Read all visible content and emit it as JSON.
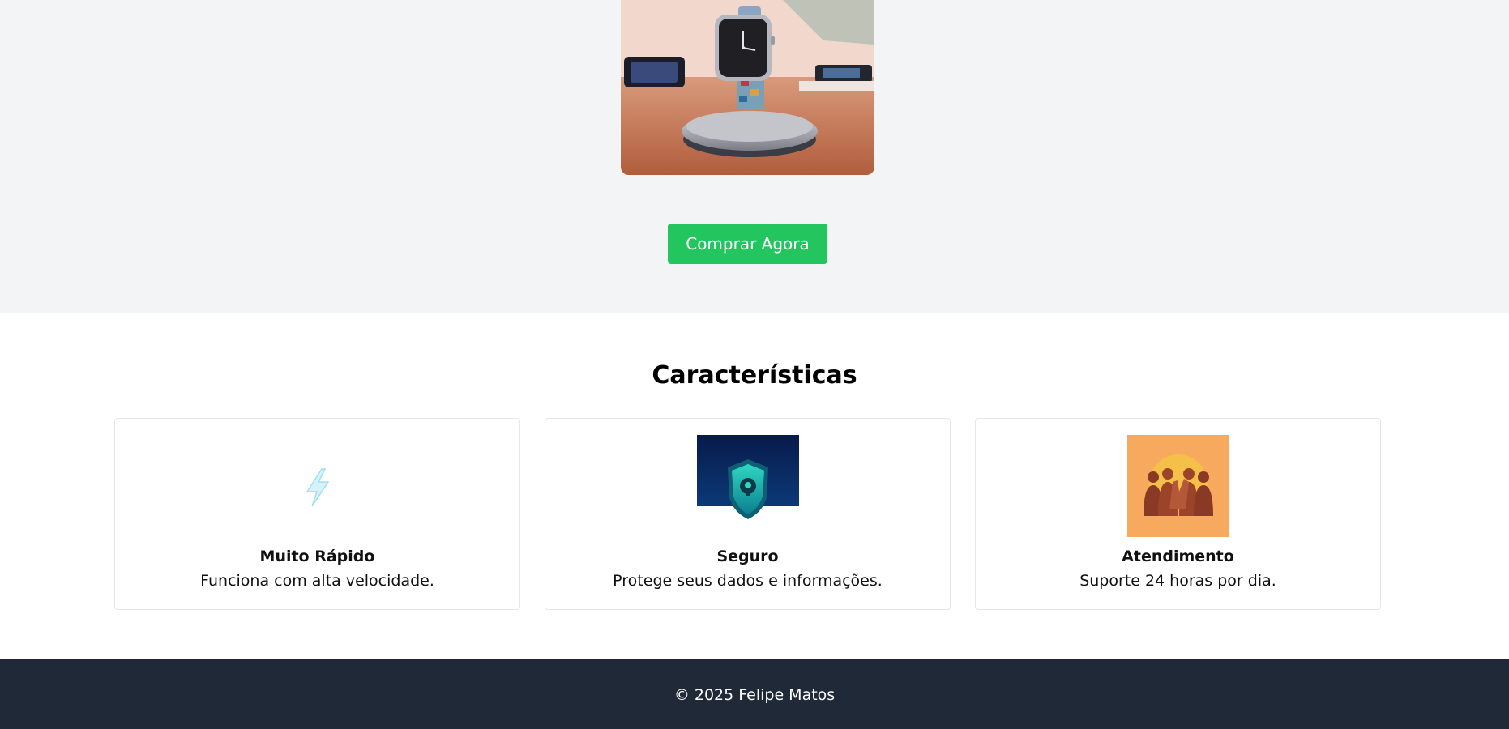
{
  "hero": {
    "image_alt": "smartwatch",
    "buy_label": "Comprar Agora"
  },
  "features": {
    "title": "Características",
    "cards": [
      {
        "icon": "lightning-icon",
        "title": "Muito Rápido",
        "description": "Funciona com alta velocidade."
      },
      {
        "icon": "shield-lock-icon",
        "title": "Seguro",
        "description": "Protege seus dados e informações."
      },
      {
        "icon": "support-people-icon",
        "title": "Atendimento",
        "description": "Suporte 24 horas por dia."
      }
    ]
  },
  "footer": {
    "copyright": "© 2025 Felipe Matos"
  },
  "colors": {
    "hero_bg": "#f3f4f6",
    "button": "#22c55e",
    "footer_bg": "#1f2937"
  }
}
